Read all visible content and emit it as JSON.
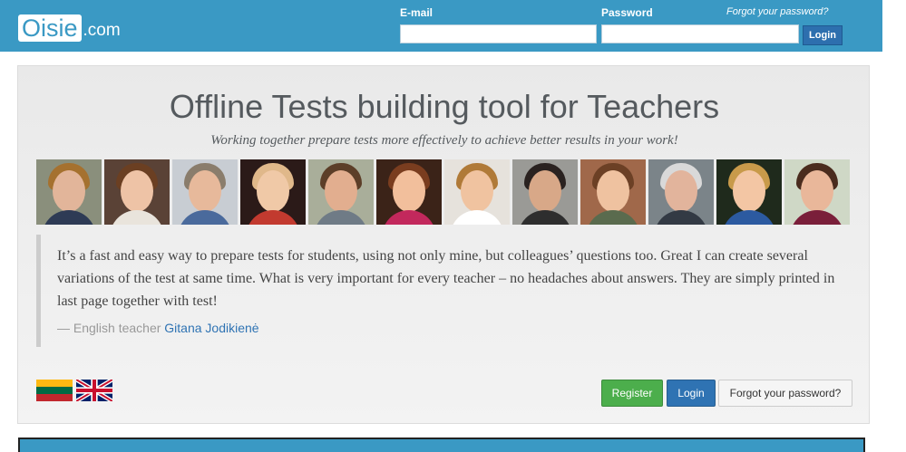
{
  "header": {
    "logo_main": "Oisie",
    "logo_suffix": ".com",
    "email_label": "E-mail",
    "password_label": "Password",
    "forgot_link": "Forgot your password?",
    "email_value": "",
    "password_value": "",
    "login_label": "Login"
  },
  "hero": {
    "title": "Offline Tests building tool for Teachers",
    "subtitle": "Working together prepare tests more effectively to achieve better results in your work!",
    "quote": "It’s a fast and easy way to prepare tests for students, using not only mine, but colleagues’ questions too. Great I can create several variations of the test at same time. What is very important for every teacher – no headaches about answers. They are simply printed in last page together with test!",
    "author_prefix": "— English teacher ",
    "author_name": "Gitana Jodikienė",
    "flags": [
      "lithuanian-flag-icon",
      "uk-flag-icon"
    ],
    "buttons": {
      "register": "Register",
      "login": "Login",
      "forgot": "Forgot your password?"
    }
  },
  "colors": {
    "header_bg": "#3a99c4",
    "login_blue": "#2f73b3",
    "register_green": "#4cae4c"
  }
}
